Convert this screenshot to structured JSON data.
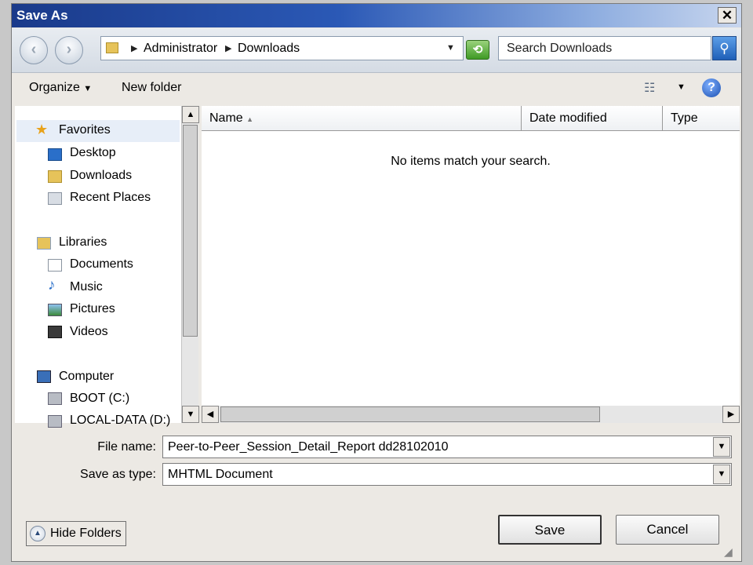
{
  "window": {
    "title": "Save As",
    "close_label": "✕"
  },
  "nav": {
    "back_icon": "back-arrow-icon",
    "forward_icon": "forward-arrow-icon",
    "breadcrumb": [
      "Administrator",
      "Downloads"
    ],
    "search_placeholder": "Search Downloads"
  },
  "toolbar": {
    "organize_label": "Organize",
    "new_folder_label": "New folder",
    "help_label": "?"
  },
  "sidebar": {
    "favorites": {
      "label": "Favorites",
      "items": [
        "Desktop",
        "Downloads",
        "Recent Places"
      ]
    },
    "libraries": {
      "label": "Libraries",
      "items": [
        "Documents",
        "Music",
        "Pictures",
        "Videos"
      ]
    },
    "computer": {
      "label": "Computer",
      "items": [
        "BOOT (C:)",
        "LOCAL-DATA (D:)"
      ]
    }
  },
  "file_list": {
    "columns": [
      "Name",
      "Date modified",
      "Type"
    ],
    "sort_column": "Name",
    "empty_message": "No items match your search."
  },
  "form": {
    "file_name_label": "File name:",
    "file_name_value": "Peer-to-Peer_Session_Detail_Report dd28102010",
    "save_type_label": "Save as type:",
    "save_type_value": "MHTML Document"
  },
  "buttons": {
    "hide_folders": "Hide Folders",
    "save": "Save",
    "cancel": "Cancel"
  },
  "colors": {
    "title_bar": "#1a3a8a",
    "window_bg": "#ece9e4",
    "accent": "#2b59b6"
  }
}
